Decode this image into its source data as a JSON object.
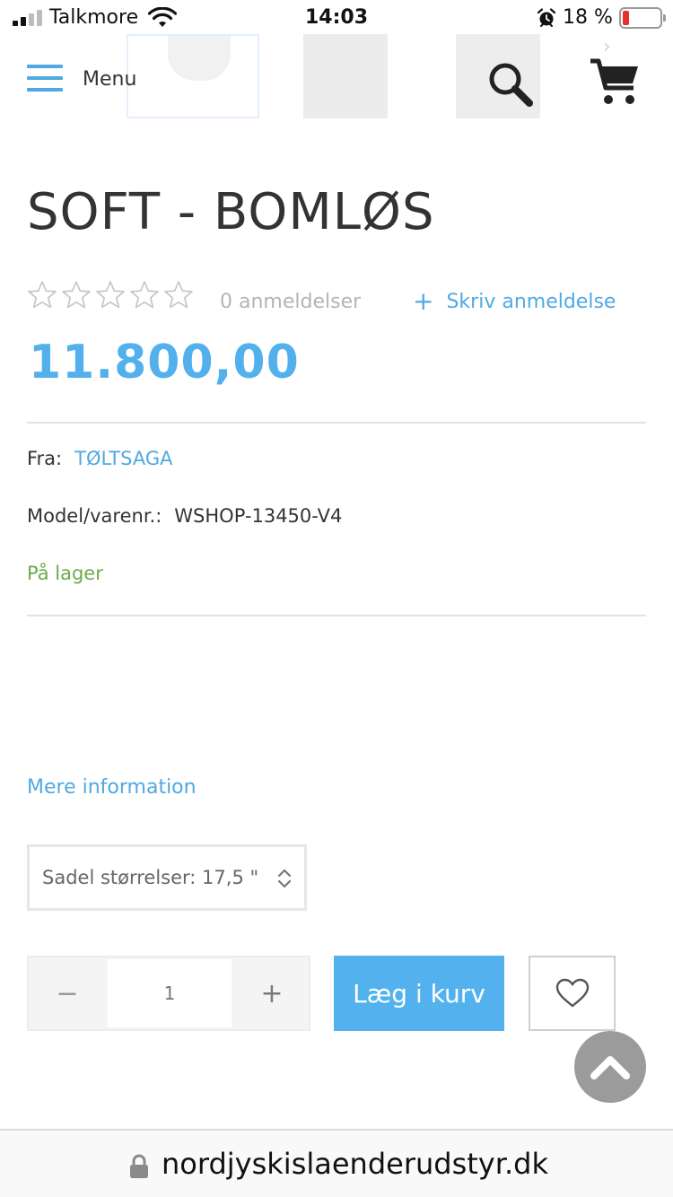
{
  "status_bar": {
    "carrier": "Talkmore",
    "time": "14:03",
    "battery_text": "18 %",
    "battery_level": 0.18,
    "battery_color": "#e5322d"
  },
  "header": {
    "menu_label": "Menu",
    "icons": [
      "menu-icon",
      "search-icon",
      "cart-icon"
    ],
    "thumbnail_count": 3
  },
  "product": {
    "title": "SOFT - BOMLØS",
    "rating": 0,
    "rating_max": 5,
    "review_count": "0 anmeldelser",
    "write_review": "Skriv anmeldelse",
    "price": "11.800,00",
    "from_label": "Fra:",
    "brand": "TØLTSAGA",
    "model_label": "Model/varenr.:",
    "model_value": "WSHOP-13450-V4",
    "stock": "På lager",
    "more_info": "Mere information",
    "option_select": "Sadel størrelser: 17,5 \"",
    "quantity": "1",
    "add_to_cart": "Læg i kurv",
    "quantity_minus": "−",
    "quantity_plus": "+"
  },
  "url_bar": {
    "url": "nordjyskislaenderudstyr.dk"
  },
  "colors": {
    "accent": "#4fa9e3",
    "price": "#52b1ec",
    "stock": "#6bab48",
    "text": "#333333"
  }
}
